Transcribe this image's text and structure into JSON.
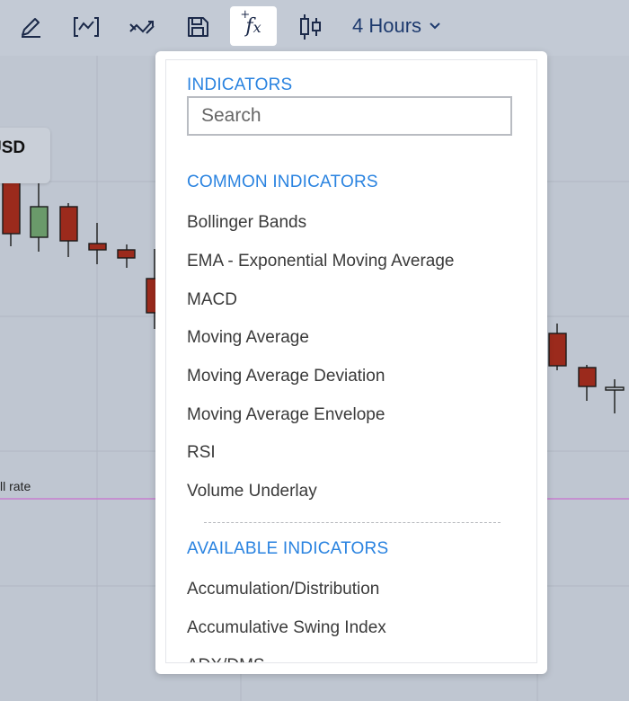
{
  "toolbar": {
    "icons": [
      "pencil-icon",
      "trend-box-icon",
      "crossing-lines-icon",
      "save-icon",
      "function-fx-icon",
      "candlestick-icon"
    ],
    "fx_label": "f",
    "fx_sub": "x",
    "fx_plus": "+",
    "period": "4 Hours",
    "active_color": "#2a83e0"
  },
  "chart": {
    "symbol": "USD",
    "rate_label": "ll rate",
    "up_color": "#6a9a6a",
    "down_color": "#9b2a1c"
  },
  "menu": {
    "indicators_title": "INDICATORS",
    "search_placeholder": "Search",
    "common_title": "COMMON INDICATORS",
    "common_items": [
      "Bollinger Bands",
      "EMA - Exponential Moving Average",
      "MACD",
      "Moving Average",
      "Moving Average Deviation",
      "Moving Average Envelope",
      "RSI",
      "Volume Underlay"
    ],
    "available_title": "AVAILABLE INDICATORS",
    "available_items": [
      "Accumulation/Distribution",
      "Accumulative Swing Index",
      "ADX/DMS"
    ]
  }
}
